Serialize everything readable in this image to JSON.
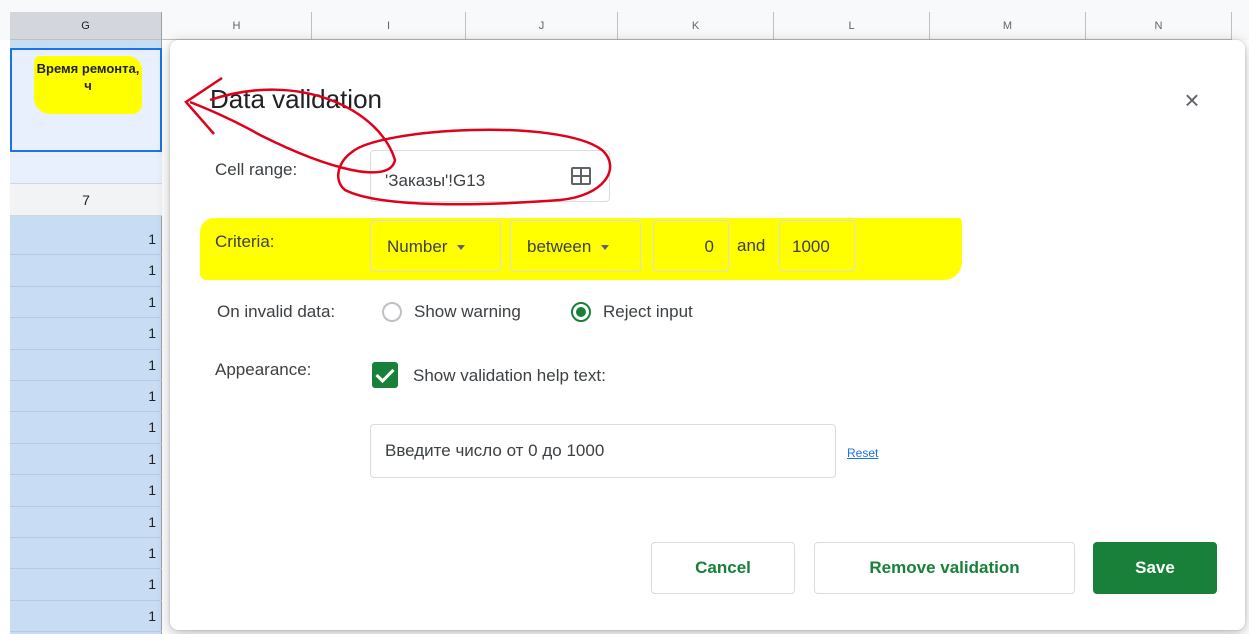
{
  "sheet": {
    "columns": [
      "G",
      "H",
      "I",
      "J",
      "K",
      "L",
      "M",
      "N"
    ],
    "selected_column": "G",
    "header_cell_text": "Время ремонта, ч",
    "frozen_value": "7",
    "row_values": [
      "1",
      "1",
      "1",
      "1",
      "1",
      "1",
      "1",
      "1",
      "1",
      "1",
      "1",
      "1",
      "1"
    ]
  },
  "dialog": {
    "title": "Data validation",
    "close_symbol": "×",
    "cell_range_label": "Cell range:",
    "cell_range_value": "'Заказы'!G13",
    "criteria_label": "Criteria:",
    "criteria_type": "Number",
    "criteria_condition": "between",
    "criteria_min": "0",
    "criteria_and": "and",
    "criteria_max": "1000",
    "invalid_label": "On invalid data:",
    "invalid_options": [
      {
        "label": "Show warning",
        "selected": false
      },
      {
        "label": "Reject input",
        "selected": true
      }
    ],
    "appearance_label": "Appearance:",
    "show_help_label": "Show validation help text:",
    "show_help_checked": true,
    "help_text": "Введите число от 0 до 1000",
    "reset_label": "Reset",
    "cancel_label": "Cancel",
    "remove_label": "Remove validation",
    "save_label": "Save"
  },
  "colors": {
    "accent_green": "#188038",
    "highlight_yellow": "#ffff00",
    "annotation_red": "#e0001a",
    "selection_blue": "#1a73e8"
  }
}
